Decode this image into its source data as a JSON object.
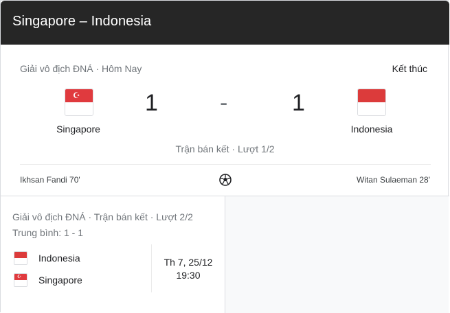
{
  "header": {
    "title": "Singapore – Indonesia"
  },
  "match": {
    "competition": "Giải vô địch ĐNÁ · Hôm Nay",
    "status": "Kết thúc",
    "home": {
      "name": "Singapore",
      "score": "1",
      "flag_top": "#e03a3e",
      "flag_symbol": "☪"
    },
    "away": {
      "name": "Indonesia",
      "score": "1",
      "flag_top": "#dc3b3b"
    },
    "separator": "-",
    "round": "Trận bán kết · Lượt 1/2",
    "home_scorer": "Ikhsan Fandi 70'",
    "away_scorer": "Witan Sulaeman 28'",
    "goal_icon": "soccer-ball-icon"
  },
  "next_match": {
    "competition": "Giải vô địch ĐNÁ · Trận bán kết · Lượt 2/2",
    "aggregate": "Trung bình: 1 - 1",
    "teams": [
      {
        "name": "Indonesia",
        "flag_top": "#dc3b3b"
      },
      {
        "name": "Singapore",
        "flag_top": "#e03a3e"
      }
    ],
    "date": "Th 7, 25/12",
    "time": "19:30"
  }
}
